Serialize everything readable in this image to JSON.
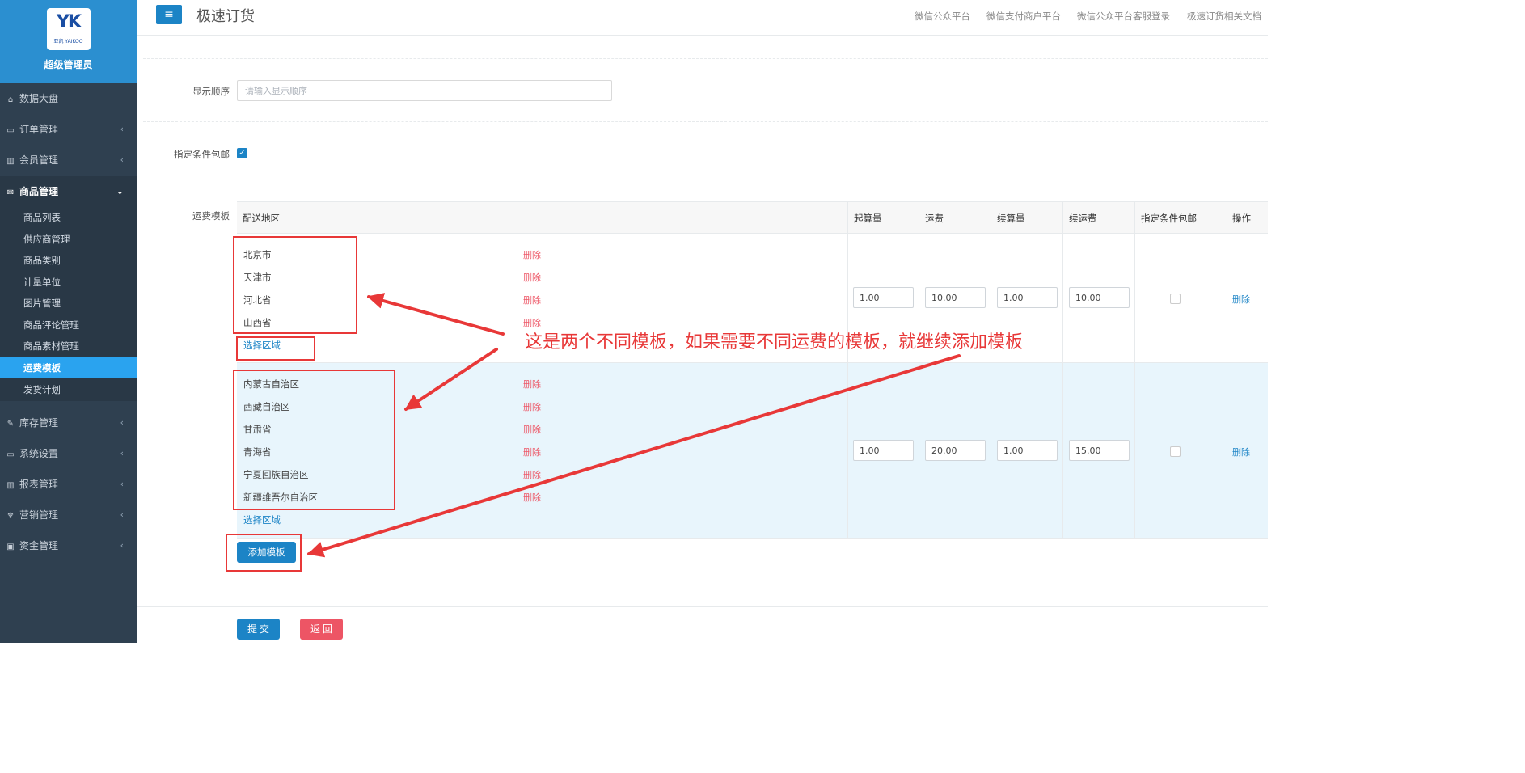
{
  "header": {
    "title": "极速订货",
    "links": [
      "微信公众平台",
      "微信支付商户平台",
      "微信公众平台客服登录",
      "极速订货相关文档"
    ]
  },
  "sidebar": {
    "logo_text": "YK",
    "logo_sub": "亚凯 YAIKOO",
    "user": "超级管理员",
    "items": [
      {
        "label": "数据大盘",
        "icon": "home-icon"
      },
      {
        "label": "订单管理",
        "icon": "order-icon"
      },
      {
        "label": "会员管理",
        "icon": "bar-chart-icon"
      },
      {
        "label": "商品管理",
        "icon": "envelope-icon"
      },
      {
        "label": "库存管理",
        "icon": "edit-icon"
      },
      {
        "label": "系统设置",
        "icon": "monitor-icon"
      },
      {
        "label": "报表管理",
        "icon": "report-icon"
      },
      {
        "label": "营销管理",
        "icon": "restaurant-icon"
      },
      {
        "label": "资金管理",
        "icon": "money-icon"
      }
    ],
    "submenu": [
      "商品列表",
      "供应商管理",
      "商品类别",
      "计量单位",
      "图片管理",
      "商品评论管理",
      "商品素材管理",
      "运费模板",
      "发货计划"
    ],
    "active_sub": "运费模板"
  },
  "form": {
    "order_label": "显示顺序",
    "order_placeholder": "请输入显示顺序",
    "free_label": "指定条件包邮",
    "template_label": "运费模板"
  },
  "table": {
    "headers": [
      "配送地区",
      "起算量",
      "运费",
      "续算量",
      "续运费",
      "指定条件包邮",
      "操作"
    ],
    "delete_label": "删除",
    "pick_label": "选择区域",
    "rows": [
      {
        "regions": [
          "北京市",
          "天津市",
          "河北省",
          "山西省"
        ],
        "start": "1.00",
        "fee": "10.00",
        "extra": "1.00",
        "extra_fee": "10.00",
        "free": false
      },
      {
        "regions": [
          "内蒙古自治区",
          "西藏自治区",
          "甘肃省",
          "青海省",
          "宁夏回族自治区",
          "新疆维吾尔自治区"
        ],
        "start": "1.00",
        "fee": "20.00",
        "extra": "1.00",
        "extra_fee": "15.00",
        "free": false
      }
    ]
  },
  "buttons": {
    "add_template": "添加模板",
    "submit": "提交",
    "back": "返回"
  },
  "annotation": {
    "text": "这是两个不同模板，如果需要不同运费的模板，就继续添加模板",
    "color": "#e83838"
  }
}
